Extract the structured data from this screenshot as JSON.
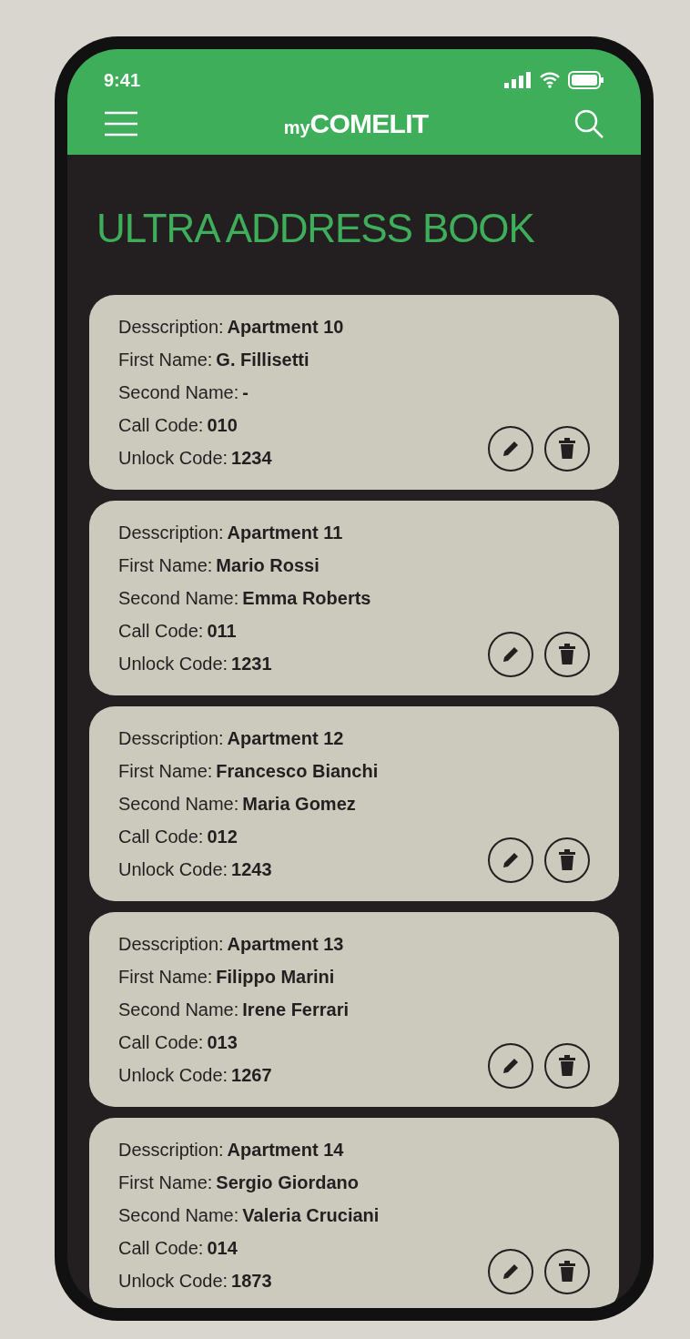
{
  "status_bar": {
    "time": "9:41"
  },
  "header": {
    "logo_prefix": "my",
    "logo_name": "COMELIT"
  },
  "title": "ULTRA ADDRESS BOOK",
  "entries": [
    {
      "fields": [
        {
          "label": "Desscription:",
          "value": "Apartment 10"
        },
        {
          "label": "First Name:",
          "value": "G. Fillisetti"
        },
        {
          "label": "Second Name:",
          "value": "-"
        },
        {
          "label": "Call Code:",
          "value": "010"
        },
        {
          "label": "Unlock Code:",
          "value": "1234"
        }
      ]
    },
    {
      "fields": [
        {
          "label": "Desscription:",
          "value": "Apartment 11"
        },
        {
          "label": "First Name:",
          "value": "Mario Rossi"
        },
        {
          "label": "Second Name:",
          "value": "Emma Roberts"
        },
        {
          "label": "Call Code:",
          "value": "011"
        },
        {
          "label": "Unlock Code:",
          "value": "1231"
        }
      ]
    },
    {
      "fields": [
        {
          "label": "Desscription:",
          "value": "Apartment 12"
        },
        {
          "label": "First Name:",
          "value": "Francesco Bianchi"
        },
        {
          "label": "Second Name:",
          "value": "Maria Gomez"
        },
        {
          "label": "Call Code:",
          "value": "012"
        },
        {
          "label": "Unlock Code:",
          "value": "1243"
        }
      ]
    },
    {
      "fields": [
        {
          "label": "Desscription:",
          "value": "Apartment 13"
        },
        {
          "label": "First Name:",
          "value": "Filippo Marini"
        },
        {
          "label": "Second Name:",
          "value": "Irene Ferrari"
        },
        {
          "label": "Call Code:",
          "value": "013"
        },
        {
          "label": "Unlock Code:",
          "value": "1267"
        }
      ]
    },
    {
      "fields": [
        {
          "label": "Desscription:",
          "value": "Apartment 14"
        },
        {
          "label": "First Name:",
          "value": "Sergio Giordano"
        },
        {
          "label": "Second Name:",
          "value": "Valeria Cruciani"
        },
        {
          "label": "Call Code:",
          "value": "014"
        },
        {
          "label": "Unlock Code:",
          "value": "1873"
        }
      ]
    }
  ]
}
